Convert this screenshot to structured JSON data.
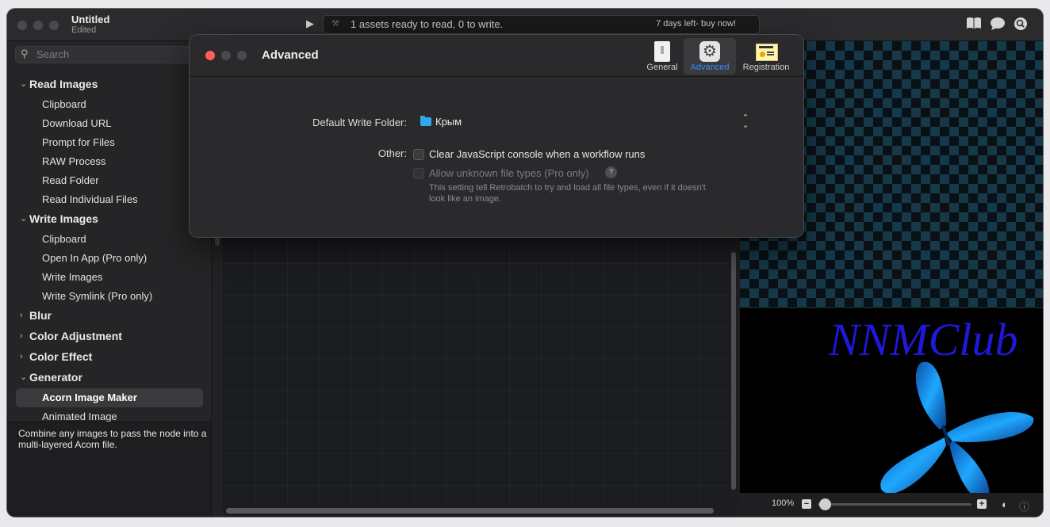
{
  "window": {
    "title": "Untitled",
    "subtitle": "Edited",
    "status_text": "1 assets ready to read, 0 to write.",
    "trial_text": "7 days left- buy now!",
    "toolbar_icons": [
      "book-icon",
      "chat-icon",
      "inspect-icon"
    ]
  },
  "sidebar": {
    "search_placeholder": "Search",
    "groups": {
      "read": {
        "label": "Read Images",
        "expanded": true,
        "items": [
          "Clipboard",
          "Download URL",
          "Prompt for Files",
          "RAW Process",
          "Read Folder",
          "Read Individual Files"
        ]
      },
      "write": {
        "label": "Write Images",
        "expanded": true,
        "items": [
          "Clipboard",
          "Open In App (Pro only)",
          "Write Images",
          "Write Symlink (Pro only)"
        ]
      },
      "blur": {
        "label": "Blur",
        "expanded": false
      },
      "color_adjustment": {
        "label": "Color Adjustment",
        "expanded": false
      },
      "color_effect": {
        "label": "Color Effect",
        "expanded": false
      },
      "generator": {
        "label": "Generator",
        "expanded": true,
        "items": [
          "Acorn Image Maker",
          "Animated Image"
        ],
        "selected": "Acorn Image Maker"
      }
    },
    "description": "Combine any images to pass the node into a multi-layered Acorn file."
  },
  "preview": {
    "image_text": "NNMClub",
    "zoom": "100%",
    "zoom_level_fraction": 0.05
  },
  "preferences": {
    "title": "Advanced",
    "tabs": [
      "General",
      "Advanced",
      "Registration"
    ],
    "active_tab": "Advanced",
    "registration_icon_text": "ID Number",
    "default_write_folder_label": "Default Write Folder:",
    "default_write_folder_value": "Крым",
    "other_label": "Other:",
    "option_clear_console": {
      "label": "Clear JavaScript console when a workflow runs",
      "checked": false,
      "enabled": true
    },
    "option_unknown_types": {
      "label": "Allow unknown file types (Pro only)",
      "checked": false,
      "enabled": false
    },
    "help_glyph": "?",
    "option_note": "This setting tell Retrobatch to try and load all file types, even if it doesn't look like an image."
  },
  "colors": {
    "accent": "#3a8bfd",
    "close_red": "#ff5f57",
    "logo_blue": "#1f18d9",
    "folder_blue": "#34a6ee"
  }
}
